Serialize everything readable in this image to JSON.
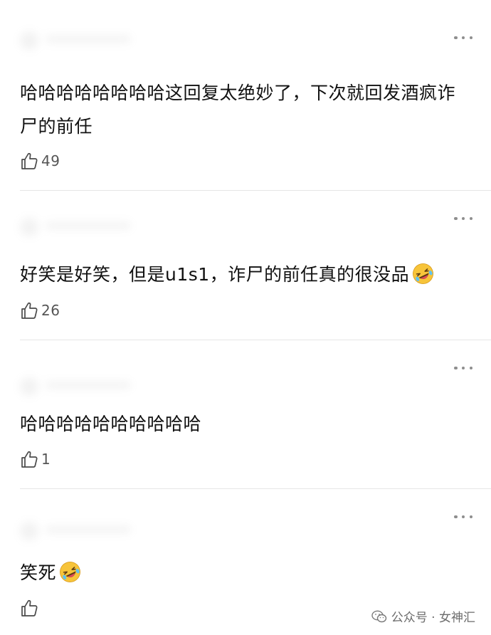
{
  "comments": [
    {
      "text": "哈哈哈哈哈哈哈哈这回复太绝妙了，下次就回发酒疯诈尸的前任",
      "likes": "49",
      "has_emoji": false
    },
    {
      "text": "好笑是好笑，但是u1s1，诈尸的前任真的很没品",
      "likes": "26",
      "has_emoji": true
    },
    {
      "text": "哈哈哈哈哈哈哈哈哈哈",
      "likes": "1",
      "has_emoji": false
    },
    {
      "text": "笑死",
      "likes": "",
      "has_emoji": true
    }
  ],
  "watermark": {
    "label": "公众号 · 女神汇"
  },
  "icons": {
    "more": "more-dots-icon",
    "like": "thumbs-up-icon",
    "emoji": "rolling-laughing-emoji-icon",
    "wechat": "wechat-icon"
  },
  "colors": {
    "text": "#111111",
    "meta": "#555555",
    "divider": "#e6e6e6",
    "emoji_face": "#F7C43A"
  }
}
